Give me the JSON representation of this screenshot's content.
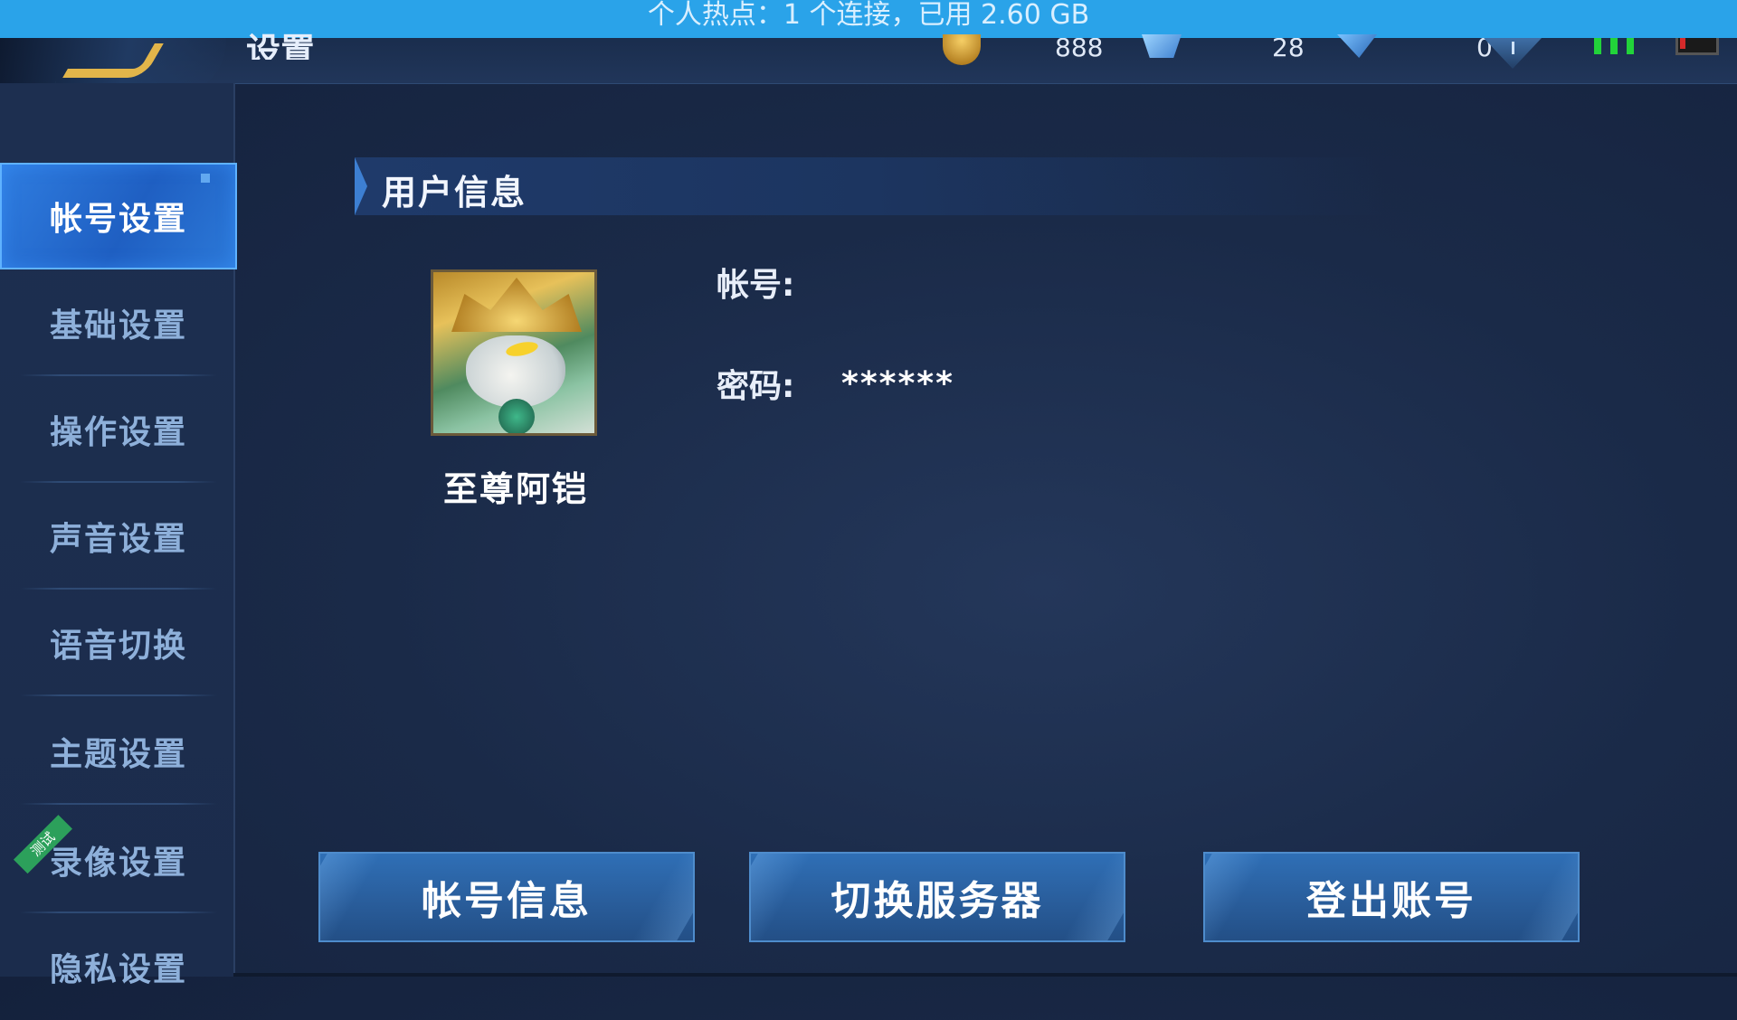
{
  "status_bar": {
    "hotspot_text": "个人热点：1 个连接，已用 2.60 GB"
  },
  "header": {
    "title": "设置",
    "currencies": [
      {
        "icon": "gold-coin-icon",
        "value": "888"
      },
      {
        "icon": "diamond-icon",
        "value": "28"
      },
      {
        "icon": "voucher-icon",
        "value": "0"
      }
    ]
  },
  "sidebar": {
    "items": [
      {
        "label": "帐号设置",
        "active": true
      },
      {
        "label": "基础设置"
      },
      {
        "label": "操作设置"
      },
      {
        "label": "声音设置"
      },
      {
        "label": "语音切换"
      },
      {
        "label": "主题设置"
      },
      {
        "label": "录像设置",
        "badge": "测试"
      },
      {
        "label": "隐私设置"
      }
    ]
  },
  "user_info": {
    "section_title": "用户信息",
    "nickname": "至尊阿铠",
    "account_label": "帐号:",
    "account_value": "",
    "password_label": "密码:",
    "password_value": "******"
  },
  "actions": {
    "account_info": "帐号信息",
    "switch_server": "切换服务器",
    "logout": "登出账号"
  },
  "colors": {
    "banner": "#2aa3e9",
    "active_tab": "#2f7de0",
    "background": "#1a2a48",
    "signal": "#22d33a"
  }
}
